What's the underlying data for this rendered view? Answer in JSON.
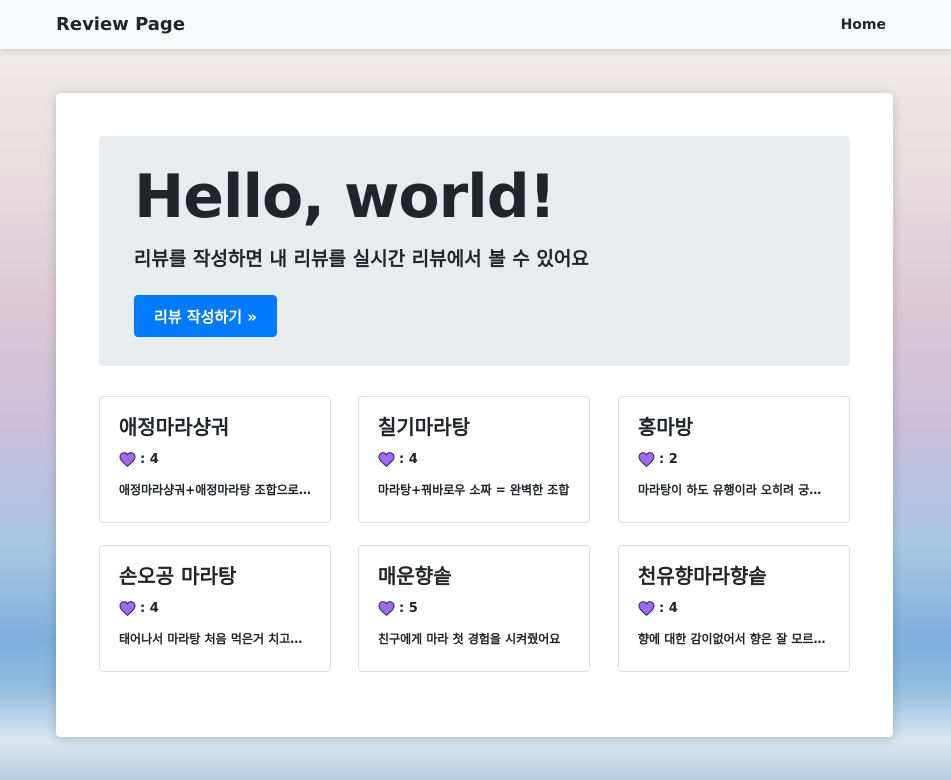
{
  "navbar": {
    "brand": "Review Page",
    "home_link": "Home"
  },
  "hero": {
    "title": "Hello, world!",
    "subtitle": "리뷰를 작성하면 내 리뷰를 실시간 리뷰에서 볼 수 있어요",
    "button_label": "리뷰 작성하기 »"
  },
  "colors": {
    "accent": "#007bff",
    "heart": "#9b6cf0",
    "jumbotron_bg": "#e9ecef"
  },
  "cards": [
    {
      "title": "애정마라샹궈",
      "likes": ": 4",
      "excerpt": "애정마라샹궈+애정마라탕 조합으로 먹었어요"
    },
    {
      "title": "칠기마라탕",
      "likes": ": 4",
      "excerpt": "마라탕+꿔바로우 소짜 = 완벽한 조합"
    },
    {
      "title": "홍마방",
      "likes": ": 2",
      "excerpt": "마라탕이 하도 유행이라 오히려 궁금했어요"
    },
    {
      "title": "손오공 마라탕",
      "likes": ": 4",
      "excerpt": "태어나서 마라탕 처음 먹은거 치고는 괜찮아요"
    },
    {
      "title": "매운향솥",
      "likes": ": 5",
      "excerpt": "친구에게 마라 첫 경험을 시켜줬어요"
    },
    {
      "title": "천유향마라향솥",
      "likes": ": 4",
      "excerpt": "향에 대한 감이없어서 향은 잘 모르겠어요"
    }
  ]
}
